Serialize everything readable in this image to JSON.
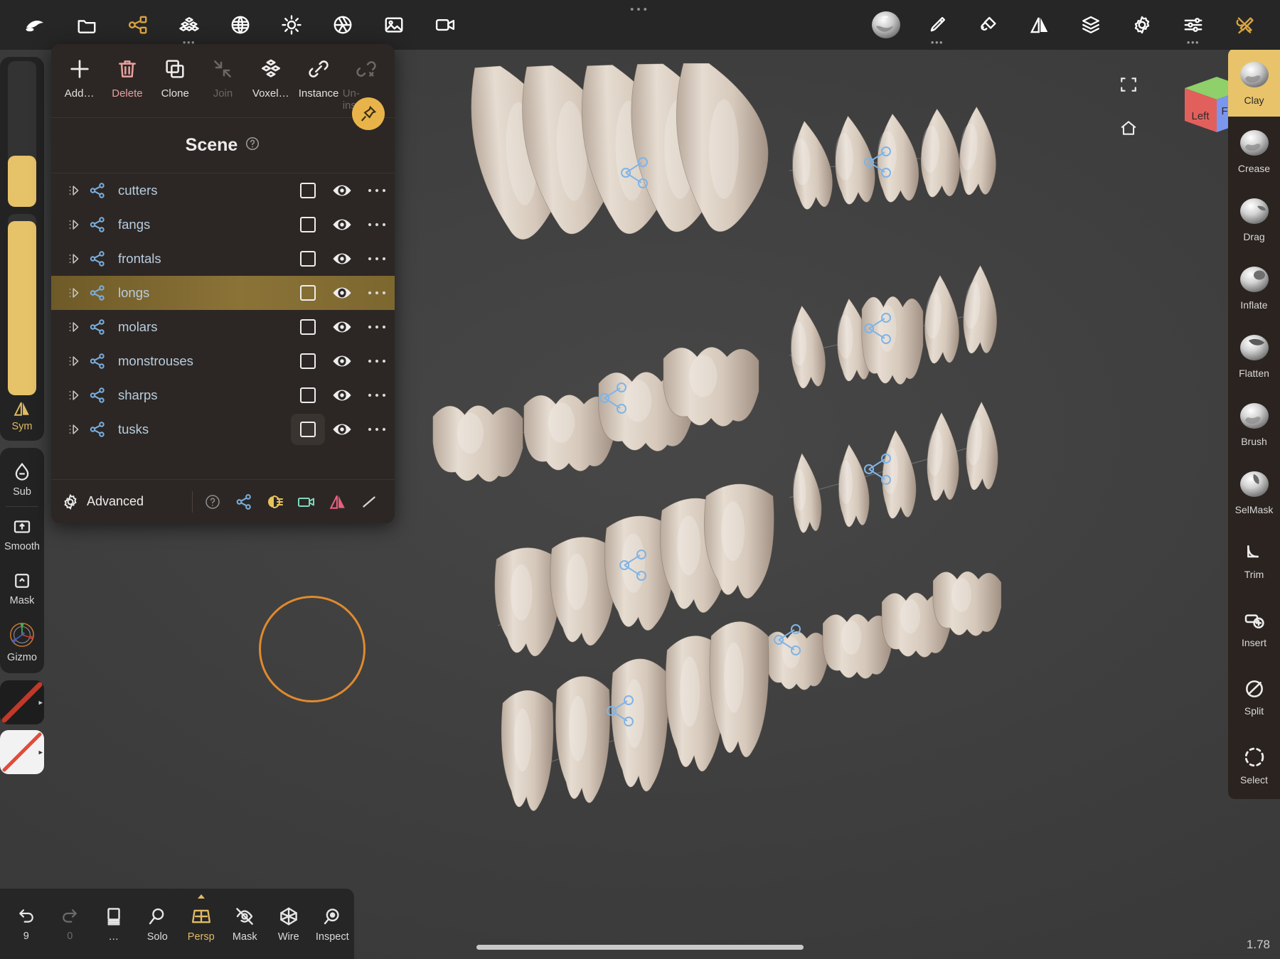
{
  "app": {
    "name": "Nomad Sculpt",
    "brush_size_value": "1.78"
  },
  "topbar": {
    "left_items": [
      {
        "name": "nomad-logo-icon",
        "label": "Nomad",
        "accent": "#ffffff",
        "has_dots": false
      },
      {
        "name": "folder-icon",
        "label": "Files",
        "accent": "#ffffff",
        "has_dots": false
      },
      {
        "name": "scene-graph-icon",
        "label": "Scene",
        "accent": "#d9a441",
        "has_dots": false
      },
      {
        "name": "topology-icon",
        "label": "Topology",
        "accent": "#ffffff",
        "has_dots": true
      },
      {
        "name": "material-sphere-icon",
        "label": "Material",
        "accent": "#ffffff",
        "has_dots": false
      },
      {
        "name": "lighting-icon",
        "label": "Lighting",
        "accent": "#ffffff",
        "has_dots": false
      },
      {
        "name": "post-process-icon",
        "label": "Post Process",
        "accent": "#ffffff",
        "has_dots": false
      },
      {
        "name": "background-image-icon",
        "label": "Background",
        "accent": "#ffffff",
        "has_dots": false
      },
      {
        "name": "render-video-icon",
        "label": "Render",
        "accent": "#ffffff",
        "has_dots": false
      }
    ],
    "right_items": [
      {
        "name": "matcap-preview-icon",
        "label": "Matcap",
        "accent": "#ffffff",
        "has_dots": false
      },
      {
        "name": "paint-brush-icon",
        "label": "Paint",
        "accent": "#ffffff",
        "has_dots": true
      },
      {
        "name": "fill-bucket-icon",
        "label": "Fill",
        "accent": "#ffffff",
        "has_dots": false
      },
      {
        "name": "symmetry-icon",
        "label": "Symmetry",
        "accent": "#ffffff",
        "has_dots": false
      },
      {
        "name": "layers-icon",
        "label": "Layers",
        "accent": "#ffffff",
        "has_dots": false
      },
      {
        "name": "settings-gear-icon",
        "label": "Settings",
        "accent": "#ffffff",
        "has_dots": false
      },
      {
        "name": "sliders-icon",
        "label": "Sliders",
        "accent": "#ffffff",
        "has_dots": true
      },
      {
        "name": "tools-icon",
        "label": "Tools",
        "accent": "#d9a441",
        "has_dots": false
      }
    ]
  },
  "left_sidebar": {
    "sliders": [
      {
        "name": "radius-slider",
        "value_pct": 35
      },
      {
        "name": "intensity-slider",
        "value_pct": 96
      }
    ],
    "symmetry": {
      "label": "Sym",
      "active": true
    },
    "items": [
      {
        "name": "sub-mode-button",
        "label": "Sub",
        "icon": "droplet-minus-icon"
      },
      {
        "name": "smooth-button",
        "label": "Smooth",
        "icon": "arrow-up-box-icon"
      },
      {
        "name": "mask-button",
        "label": "Mask",
        "icon": "chevron-up-box-icon"
      },
      {
        "name": "gizmo-button",
        "label": "Gizmo",
        "icon": "gizmo-axis-icon"
      }
    ],
    "swatches": [
      {
        "name": "material-swatch",
        "color": "#1f1f1f",
        "stripe": "#c0392b"
      },
      {
        "name": "color-swatch",
        "color": "#f2f2f2",
        "stripe": "#e04b3a"
      }
    ]
  },
  "scene_panel": {
    "title": "Scene",
    "help_icon": "help-circle-icon",
    "toolbar": [
      {
        "name": "add-button",
        "label": "Add…",
        "icon": "plus-icon",
        "state": "normal"
      },
      {
        "name": "delete-button",
        "label": "Delete",
        "icon": "trash-icon",
        "state": "danger"
      },
      {
        "name": "clone-button",
        "label": "Clone",
        "icon": "copy-icon",
        "state": "normal"
      },
      {
        "name": "join-button",
        "label": "Join",
        "icon": "join-arrows-icon",
        "state": "disabled"
      },
      {
        "name": "voxel-remesh-button",
        "label": "Voxel…",
        "icon": "voxel-cubes-icon",
        "state": "normal"
      },
      {
        "name": "instance-button",
        "label": "Instance",
        "icon": "link-icon",
        "state": "normal"
      },
      {
        "name": "un-instance-button",
        "label": "Un-instance",
        "icon": "broken-link-icon",
        "state": "disabled"
      }
    ],
    "pin_button": {
      "name": "pin-button",
      "icon": "pin-icon",
      "color": "#e8b44a"
    },
    "list": [
      {
        "name": "cutters",
        "selected": false,
        "checkbox_hover": false
      },
      {
        "name": "fangs",
        "selected": false,
        "checkbox_hover": false
      },
      {
        "name": "frontals",
        "selected": false,
        "checkbox_hover": false
      },
      {
        "name": "longs",
        "selected": true,
        "checkbox_hover": false
      },
      {
        "name": "molars",
        "selected": false,
        "checkbox_hover": false
      },
      {
        "name": "monstrouses",
        "selected": false,
        "checkbox_hover": false
      },
      {
        "name": "sharps",
        "selected": false,
        "checkbox_hover": false
      },
      {
        "name": "tusks",
        "selected": false,
        "checkbox_hover": true
      }
    ],
    "row_icons": {
      "expand": "expand-triangle-icon",
      "instance": "share-nodes-icon",
      "visibility": "eye-icon",
      "more": "more-options-icon"
    },
    "footer": {
      "advanced_label": "Advanced",
      "advanced_icon": "gear-icon",
      "icons": [
        {
          "name": "help-icon",
          "color": "#8a8a8a"
        },
        {
          "name": "share-nodes-icon",
          "color": "#7aaede"
        },
        {
          "name": "light-icon",
          "color": "#e8c35a"
        },
        {
          "name": "camera-icon",
          "color": "#7fd8bd"
        },
        {
          "name": "mirror-icon",
          "color": "#e8607f"
        },
        {
          "name": "line-icon",
          "color": "#d8d8d8"
        }
      ]
    }
  },
  "right_sidebar": {
    "tools": [
      {
        "name": "clay-tool",
        "label": "Clay",
        "active": true,
        "icon": "brush-preview-clay"
      },
      {
        "name": "crease-tool",
        "label": "Crease",
        "active": false,
        "icon": "brush-preview-crease"
      },
      {
        "name": "drag-tool",
        "label": "Drag",
        "active": false,
        "icon": "brush-preview-drag"
      },
      {
        "name": "inflate-tool",
        "label": "Inflate",
        "active": false,
        "icon": "brush-preview-inflate"
      },
      {
        "name": "flatten-tool",
        "label": "Flatten",
        "active": false,
        "icon": "brush-preview-flatten"
      },
      {
        "name": "brush-tool",
        "label": "Brush",
        "active": false,
        "icon": "brush-preview-brush"
      },
      {
        "name": "selmask-tool",
        "label": "SelMask",
        "active": false,
        "icon": "brush-preview-selmask"
      },
      {
        "name": "trim-tool",
        "label": "Trim",
        "active": false,
        "icon": "trim-icon"
      },
      {
        "name": "insert-tool",
        "label": "Insert",
        "active": false,
        "icon": "insert-icon"
      },
      {
        "name": "split-tool",
        "label": "Split",
        "active": false,
        "icon": "split-icon"
      },
      {
        "name": "select-tool",
        "label": "Select",
        "active": false,
        "icon": "dashed-circle-icon"
      }
    ]
  },
  "bottombar": {
    "items": [
      {
        "name": "undo-button",
        "label": "9",
        "icon": "undo-arrow-icon",
        "style": "normal"
      },
      {
        "name": "redo-button",
        "label": "0",
        "icon": "redo-arrow-icon",
        "style": "dim"
      },
      {
        "name": "layers-list-button",
        "label": "…",
        "icon": "book-layers-icon",
        "style": "normal"
      },
      {
        "name": "solo-button",
        "label": "Solo",
        "icon": "magnifier-icon",
        "style": "normal"
      },
      {
        "name": "persp-button",
        "label": "Persp",
        "icon": "perspective-grid-icon",
        "style": "gold"
      },
      {
        "name": "mask-view-button",
        "label": "Mask",
        "icon": "eye-off-icon",
        "style": "normal"
      },
      {
        "name": "wire-button",
        "label": "Wire",
        "icon": "wireframe-icon",
        "style": "normal"
      },
      {
        "name": "inspect-button",
        "label": "Inspect",
        "icon": "inspect-eye-icon",
        "style": "normal"
      }
    ]
  },
  "viewcube": {
    "left_face_label": "Left",
    "front_face_label": "Front",
    "left_color": "#e2605c",
    "front_color": "#7a96ee",
    "top_color": "#8fd06a",
    "fullscreen_icon": "fullscreen-icon",
    "home_icon": "home-icon"
  }
}
